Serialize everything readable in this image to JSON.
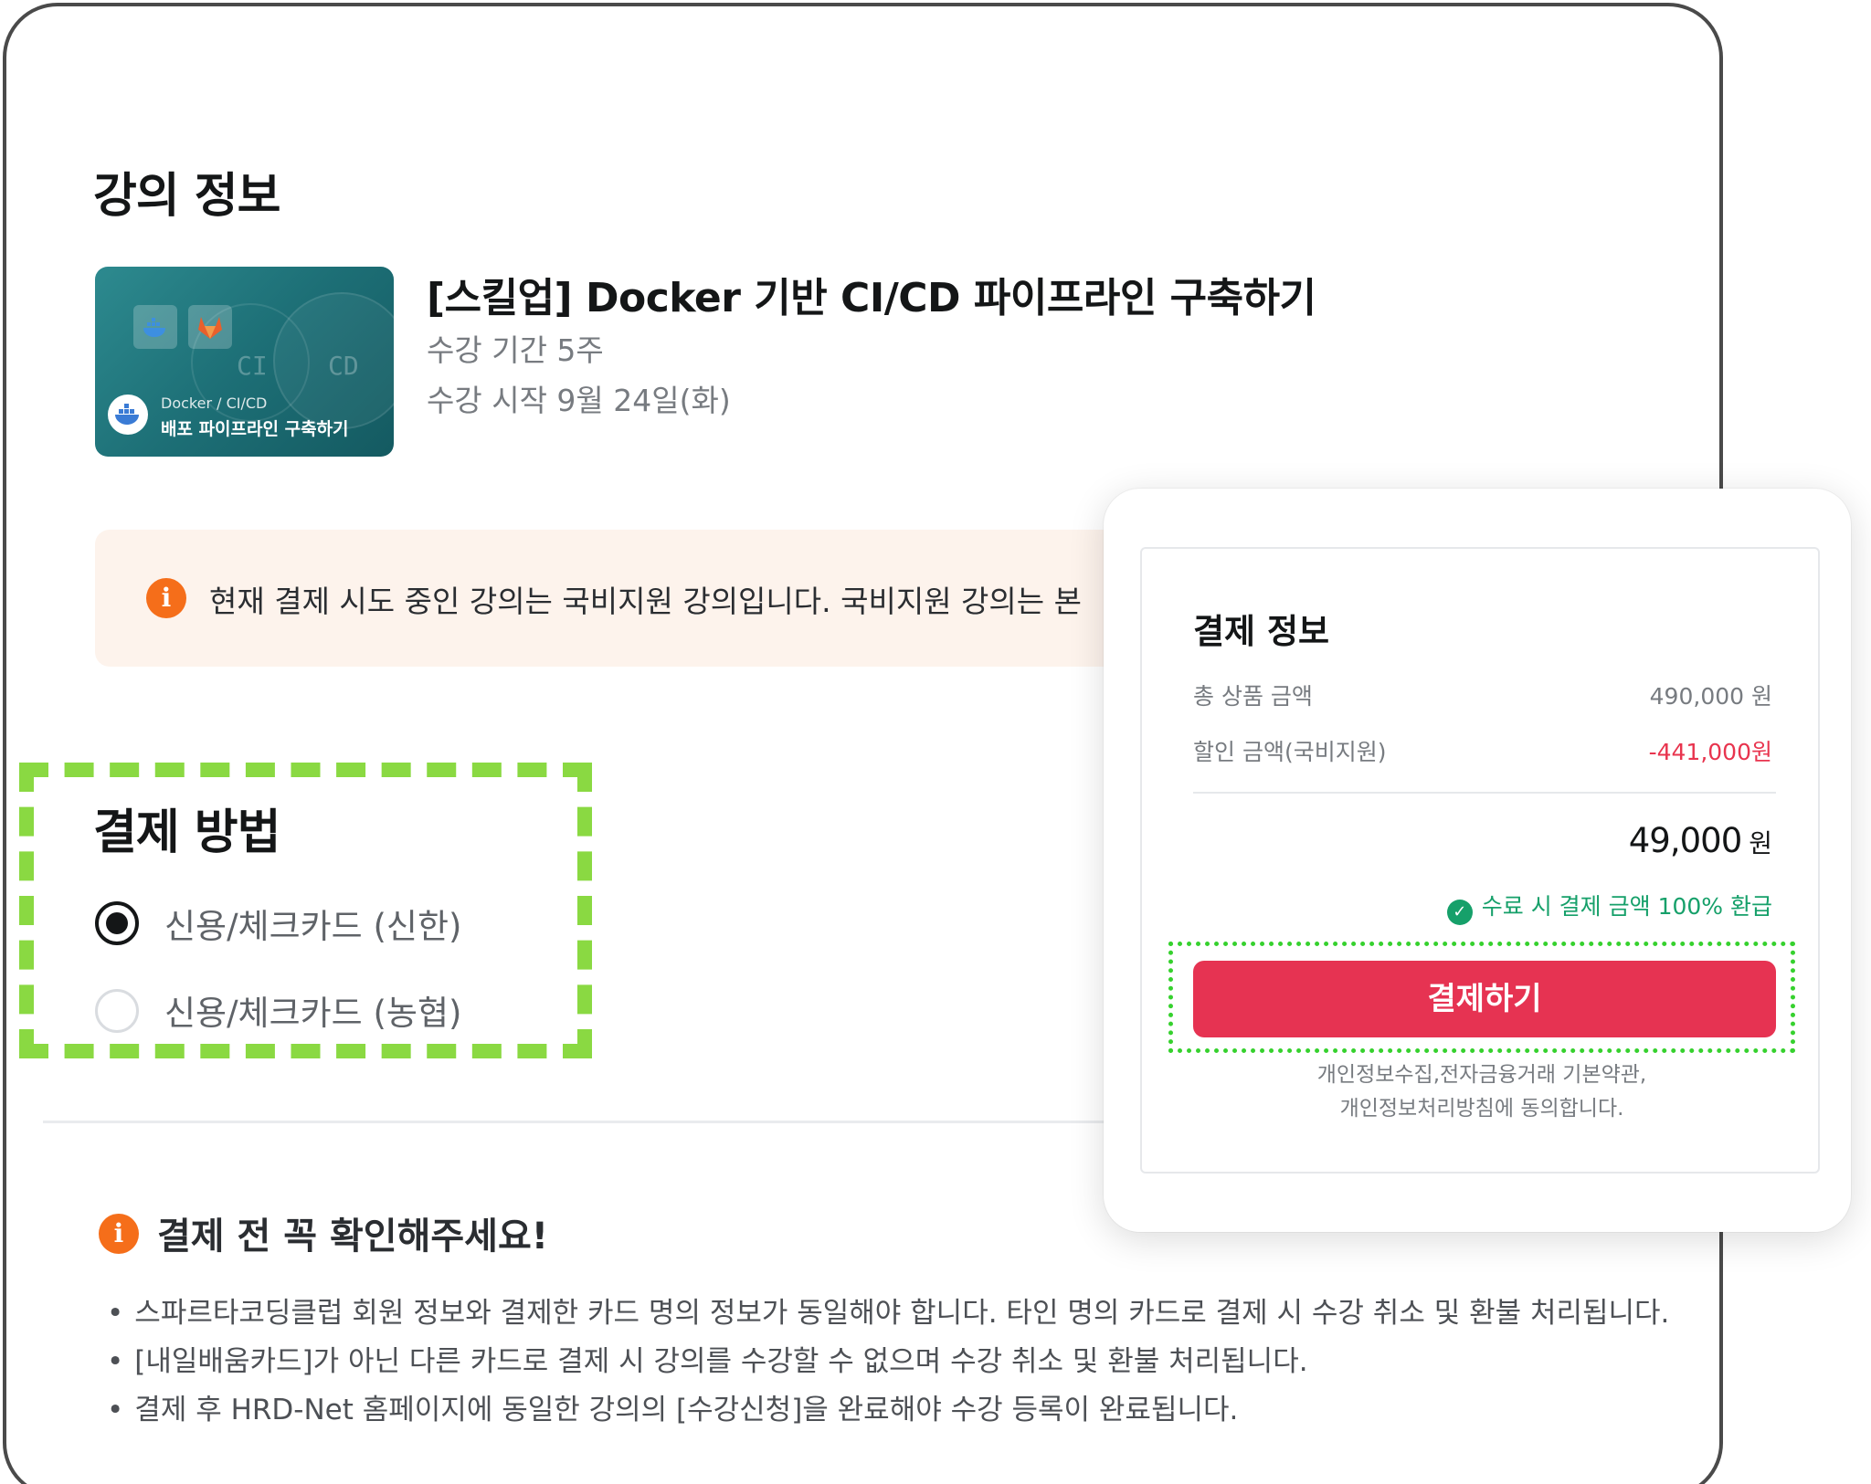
{
  "course_info": {
    "section_title": "강의 정보",
    "thumbnail": {
      "ci_text": "CI",
      "cd_text": "CD",
      "tag": "Docker / CI/CD",
      "tagline": "배포 파이프라인 구축하기"
    },
    "title": "[스킬업] Docker 기반 CI/CD 파이프라인 구축하기",
    "duration": "수강 기간 5주",
    "start_date": "수강 시작 9월 24일(화)"
  },
  "notice": {
    "icon": "info-icon",
    "text": "현재 결제 시도 중인 강의는 국비지원 강의입니다. 국비지원 강의는 본",
    "color": "#f56e1a"
  },
  "payment_method": {
    "section_title": "결제 방법",
    "options": [
      {
        "label": "신용/체크카드 (신한)",
        "selected": true
      },
      {
        "label": "신용/체크카드 (농협)",
        "selected": false
      }
    ]
  },
  "checklist": {
    "icon": "info-icon",
    "title": "결제 전 꼭 확인해주세요!",
    "items": [
      "스파르타코딩클럽 회원 정보와 결제한 카드 명의 정보가 동일해야 합니다. 타인 명의 카드로 결제 시 수강 취소 및 환불 처리됩니다.",
      "[내일배움카드]가 아닌 다른 카드로 결제 시 강의를 수강할 수 없으며 수강 취소 및 환불 처리됩니다.",
      "결제 후 HRD-Net 홈페이지에 동일한 강의의 [수강신청]을 완료해야 수강 등록이 완료됩니다."
    ]
  },
  "payment_info": {
    "title": "결제 정보",
    "rows": [
      {
        "label": "총 상품 금액",
        "value": "490,000 원"
      },
      {
        "label": "할인 금액(국비지원)",
        "value": "-441,000원"
      }
    ],
    "total_amount": "49,000",
    "total_unit": "원",
    "refund_note": "수료 시 결제 금액 100% 환급",
    "pay_button_label": "결제하기",
    "terms_line1": "개인정보수집,전자금융거래 기본약관,",
    "terms_line2": "개인정보처리방침에 동의합니다.",
    "accent_color": "#e63352",
    "discount_color": "#e8344e",
    "refund_color": "#16a06a",
    "highlight_color": "#8ad942"
  }
}
